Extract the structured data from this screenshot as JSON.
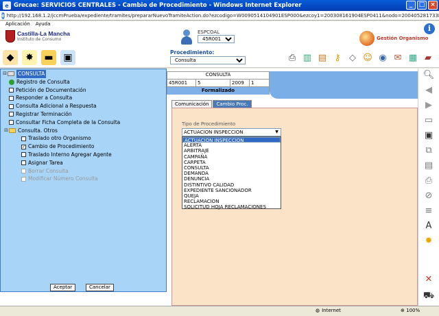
{
  "window": {
    "title": "Grecae: SERVICIOS CENTRALES - Cambio de Procedimiento - Windows Internet Explorer",
    "url": "http://192.168.1.2/jccmPrueba/expediente/tramites/prepararNuevoTramiteAction.do?ezcodigo=W0090514104901ESP000&ezcoy1=200308161904ESP0411&nodo=200405281733ESP37817#"
  },
  "menu": {
    "items": [
      "Aplicación",
      "Ayuda"
    ]
  },
  "header": {
    "logo_title": "Castilla-La Mancha",
    "logo_subtitle": "Instituto de Consumo",
    "user_label": "ESPCOAL",
    "user_select": "45R001",
    "gestion_label": "Gestión Organismo"
  },
  "toolbar": {
    "procedimiento_label": "Procedimiento:",
    "procedimiento_value": "Consulta"
  },
  "consulta": {
    "title": "CONSULTA",
    "code": "45R001",
    "num": "5",
    "year": "2009",
    "seq": "1",
    "state": "Formalizado"
  },
  "tabs": [
    "Comunicación",
    "Cambio Proc."
  ],
  "form": {
    "tipo_label": "Tipo de Procedimiento",
    "tipo_value": "ACTUACION INSPECCION",
    "options": [
      "ACTUACION INSPECCION",
      "ALERTA",
      "ARBITRAJE",
      "CAMPAÑA",
      "CARPETA",
      "CONSULTA",
      "DEMANDA",
      "DENUNCIA",
      "DISTINTIVO CALIDAD",
      "EXPEDIENTE SANCIONADOR",
      "QUEJA",
      "RECLAMACION",
      "SOLICITUD HOJA RECLAMACIONES"
    ]
  },
  "tree": {
    "root": "CONSULTA",
    "items": [
      {
        "label": "Registro de Consulta",
        "kind": "green"
      },
      {
        "label": "Petición de Documentación",
        "kind": "check"
      },
      {
        "label": "Responder a Consulta",
        "kind": "check"
      },
      {
        "label": "Consulta Adicional a Respuesta",
        "kind": "check"
      },
      {
        "label": "Registrar Terminación",
        "kind": "check"
      },
      {
        "label": "Consultar Ficha Completa de la Consulta",
        "kind": "check"
      }
    ],
    "sub_root": "Consulta. Otros",
    "sub_items": [
      {
        "label": "Traslado otro Organismo",
        "checked": false,
        "disabled": false
      },
      {
        "label": "Cambio de Procedimiento",
        "checked": true,
        "disabled": false
      },
      {
        "label": "Traslado Interno Agregar Agente",
        "checked": false,
        "disabled": false
      },
      {
        "label": "Asignar Tarea",
        "checked": false,
        "disabled": false
      },
      {
        "label": "Borrar Consulta",
        "checked": false,
        "disabled": true
      },
      {
        "label": "Modificar Número Consulta",
        "checked": false,
        "disabled": true
      }
    ]
  },
  "buttons": {
    "accept": "Aceptar",
    "cancel": "Cancelar"
  },
  "status": {
    "zone": "Internet",
    "zoom": "100%"
  }
}
